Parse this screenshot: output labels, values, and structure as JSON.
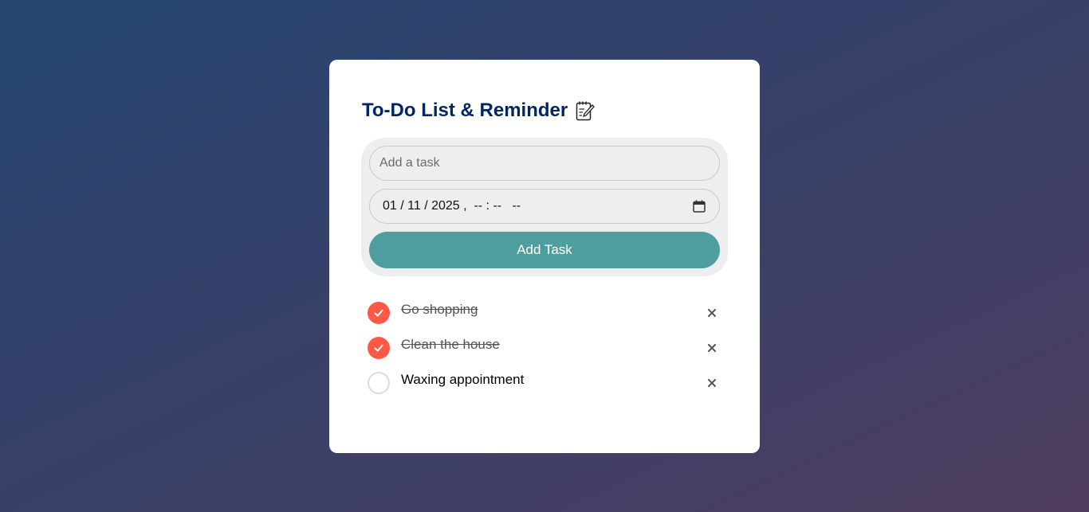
{
  "app": {
    "title": "To-Do List & Reminder",
    "title_icon": "memo-pencil-icon"
  },
  "form": {
    "task_placeholder": "Add a task",
    "task_value": "",
    "datetime_value": "01 / 11 / 2025 ,  -- : --   --",
    "calendar_icon": "calendar-icon",
    "add_button_label": "Add Task"
  },
  "tasks": [
    {
      "label": "Go shopping",
      "completed": true,
      "delete_label": "×"
    },
    {
      "label": "Clean the house",
      "completed": true,
      "delete_label": "×"
    },
    {
      "label": "Waxing appointment",
      "completed": false,
      "delete_label": "×"
    }
  ],
  "colors": {
    "title": "#002765",
    "accent_button": "#4f9e9f",
    "check_done": "#ff5945",
    "panel_bg": "#edeef0"
  }
}
